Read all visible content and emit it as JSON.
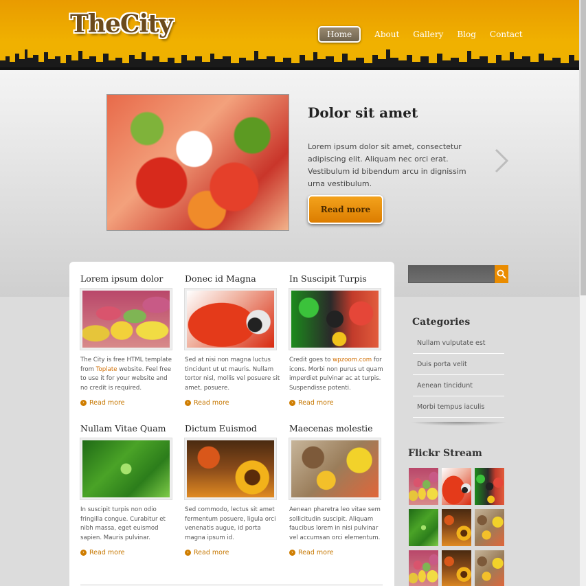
{
  "header": {
    "logo": "TheCity",
    "nav": [
      {
        "label": "Home",
        "active": true
      },
      {
        "label": "About",
        "active": false
      },
      {
        "label": "Gallery",
        "active": false
      },
      {
        "label": "Blog",
        "active": false
      },
      {
        "label": "Contact",
        "active": false
      }
    ]
  },
  "slider": {
    "title": "Dolor sit amet",
    "text": "Lorem ipsum dolor sit amet, consectetur adipiscing elit. Aliquam nec orci erat. Vestibulum id bibendum arcu in dignissim urna vestibulum.",
    "button_label": "Read more",
    "next_icon": "chevron-right-icon"
  },
  "posts": [
    {
      "title": "Lorem ipsum dolor",
      "text_before": "The City is free HTML template from ",
      "link": "Toplate",
      "text_after": " website. Feel free to use it for your website and no credit is required.",
      "more": "Read more"
    },
    {
      "title": "Donec id Magna",
      "text_before": "Sed at nisi non magna luctus tincidunt ut ut mauris. Nullam tortor nisl, mollis vel posuere sit amet, posuere.",
      "link": "",
      "text_after": "",
      "more": "Read more"
    },
    {
      "title": "In Suscipit Turpis",
      "text_before": "Credit goes to ",
      "link": "wpzoom.com",
      "text_after": " for icons. Morbi non purus ut quam imperdiet pulvinar ac at turpis. Suspendisse potenti.",
      "more": "Read more"
    },
    {
      "title": "Nullam Vitae Quam",
      "text_before": "In suscipit turpis non odio fringilla congue. Curabitur et nibh massa, eget euismod sapien. Mauris pulvinar.",
      "link": "",
      "text_after": "",
      "more": "Read more"
    },
    {
      "title": "Dictum Euismod",
      "text_before": "Sed commodo, lectus sit amet fermentum posuere, ligula orci venenatis augue, id porta magna ipsum id.",
      "link": "",
      "text_after": "",
      "more": "Read more"
    },
    {
      "title": "Maecenas molestie",
      "text_before": "Aenean pharetra leo vitae sem sollicitudin suscipit. Aliquam faucibus lorem in nisi pulvinar vel accumsan orci elementum.",
      "link": "",
      "text_after": "",
      "more": "Read more"
    }
  ],
  "sidebar": {
    "search_placeholder": "",
    "categories_title": "Categories",
    "categories": [
      "Nullam vulputate est",
      "Duis porta velit",
      "Aenean tincidunt",
      "Morbi tempus iaculis"
    ],
    "flickr_title": "Flickr Stream"
  },
  "colors": {
    "header_orange": "#efaa00",
    "accent": "#e88a00",
    "link": "#d06d00"
  }
}
